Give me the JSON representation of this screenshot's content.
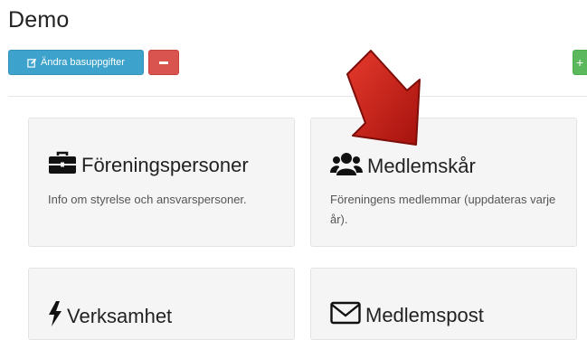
{
  "page": {
    "title": "Demo"
  },
  "toolbar": {
    "edit_label": "Ändra basuppgifter",
    "add_label": "+"
  },
  "cards": [
    {
      "title": "Föreningspersoner",
      "description": "Info om styrelse och ansvarspersoner.",
      "icon": "briefcase-icon"
    },
    {
      "title": "Medlemskår",
      "description": "Föreningens medlemmar (uppdateras varje år).",
      "icon": "users-icon"
    },
    {
      "title": "Verksamhet",
      "icon": "bolt-icon"
    },
    {
      "title": "Medlemspost",
      "icon": "envelope-icon"
    }
  ],
  "colors": {
    "edit_button": "#3da3cc",
    "remove_button": "#d9534f",
    "add_button": "#5cb85c",
    "card_bg": "#f5f5f5",
    "arrow": "#c9211b"
  },
  "annotation": {
    "icon": "red-arrow-pointer"
  }
}
